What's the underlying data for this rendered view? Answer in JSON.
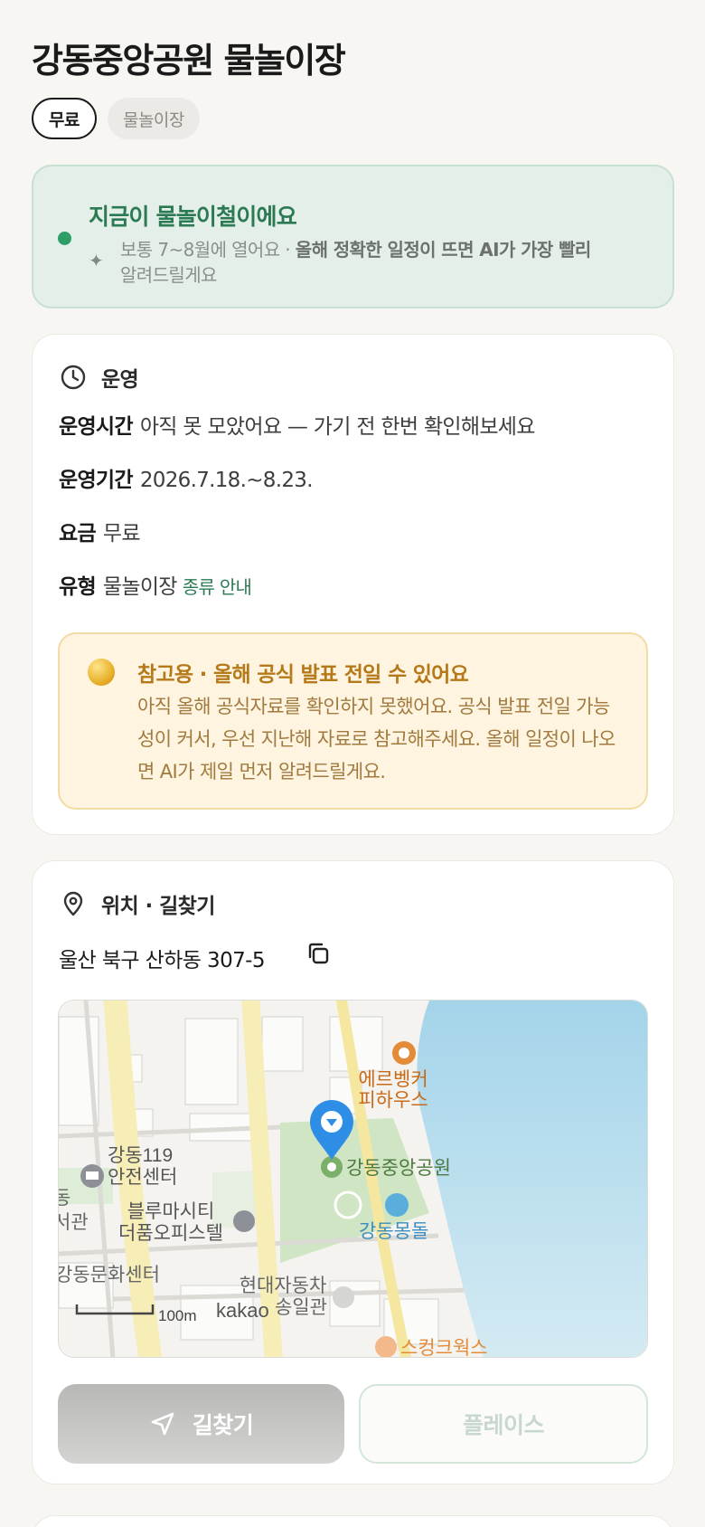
{
  "header": {
    "title": "강동중앙공원 물놀이장"
  },
  "chips": [
    {
      "label": "무료"
    },
    {
      "label": "물놀이장"
    }
  ],
  "season": {
    "title": "지금이 물놀이철이에요",
    "desc_plain": "보통 7~8월에 열어요 · ",
    "desc_bold": "올해 정확한 일정이 뜨면 AI가 가장 빨리",
    "desc_tail": "알려드릴게요",
    "accent_color": "#2f9e66"
  },
  "operation": {
    "section_title": "운영",
    "rows": [
      {
        "key": "운영시간",
        "value": "아직 못 모았어요 — 가기 전 한번 확인해보세요"
      },
      {
        "key": "운영기간",
        "value": "2026.7.18.~8.23."
      },
      {
        "key": "요금",
        "value": "무료"
      },
      {
        "key": "유형",
        "value": "물놀이장",
        "link": "종류 안내"
      }
    ],
    "notice": {
      "title": "참고용 · 올해 공식 발표 전일 수 있어요",
      "body": "아직 올해 공식자료를 확인하지 못했어요. 공식 발표 전일 가능성이 커서, 우선 지난해 자료로 참고해주세요. 올해 일정이 나오면 AI가 제일 먼저 알려드릴게요."
    }
  },
  "location": {
    "section_title": "위치 · 길찾기",
    "address": "울산 북구 산하동 307-5",
    "map": {
      "labels": {
        "cafe": "에르벵커",
        "cafe2": "피하우스",
        "fire": "강동119",
        "fire2": "안전센터",
        "park": "강동중앙공원",
        "blue": "블루마시티",
        "blue2": "더품오피스텔",
        "rock": "강동몽돌",
        "culture": "강동문화센터",
        "left1": "동",
        "left2": "서관",
        "hyundai": "현대자동차",
        "hyundai2": "송일관",
        "scale": "100m",
        "logo": "kakao",
        "skunk": "스컹크웍스"
      }
    },
    "directions_label": "길찾기",
    "place_label": "플레이스"
  }
}
